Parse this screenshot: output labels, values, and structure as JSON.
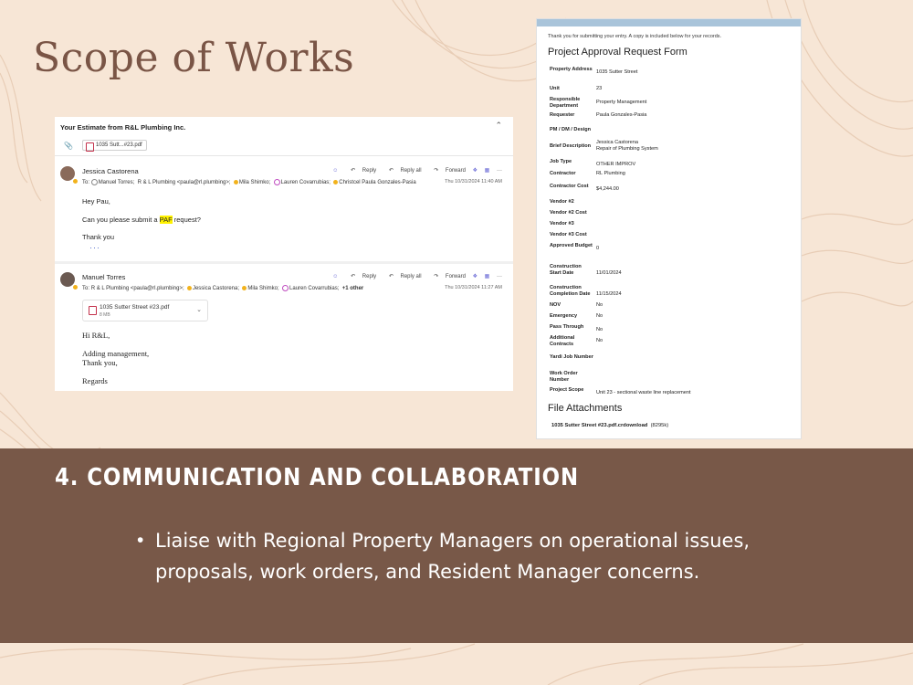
{
  "slide": {
    "title": "Scope of Works",
    "colors": {
      "background": "#f7e6d6",
      "band": "#785848",
      "title": "#7a5546"
    }
  },
  "email": {
    "subject": "Your Estimate from R&L Plumbing Inc.",
    "attachment_chip": "1035 Sutt...#23.pdf",
    "actions": {
      "reply": "Reply",
      "reply_all": "Reply all",
      "forward": "Forward",
      "more": "···"
    },
    "message1": {
      "sender": "Jessica Castorena",
      "to_label": "To:",
      "recipients": [
        "Manuel Torres;",
        "R & L Plumbing <paula@rl.plumbing>;",
        "Mila Shimko;",
        "Lauren Covarrubias;",
        "Christcel Paula Gonzales-Pasia"
      ],
      "date": "Thu 10/31/2024 11:40 AM",
      "greeting": "Hey Pau,",
      "line_before": "Can you please submit a ",
      "highlight": "PAF",
      "line_after": " request?",
      "closing": "Thank you",
      "expand": "···"
    },
    "message2": {
      "sender": "Manuel Torres",
      "to_label": "To:",
      "recipients": [
        "R & L Plumbing <paula@rl.plumbing>;",
        "Jessica Castorena;",
        "Mila Shimko;",
        "Lauren Covarrubias;"
      ],
      "others": "+1 other",
      "date": "Thu 10/31/2024 11:27 AM",
      "attachment_name": "1035 Sutter Street #23.pdf",
      "attachment_size": "8 MB",
      "greeting": "Hi R&L,",
      "line1": "Adding management,",
      "line2": "Thank you,",
      "closing": "Regards"
    }
  },
  "form": {
    "thanks": "Thank you for submitting your entry. A copy is included below for your records.",
    "title": "Project Approval Request Form",
    "fields": [
      {
        "label": "Property Address",
        "value": "1035 Sutter Street"
      },
      {
        "label": "Unit",
        "value": "23"
      },
      {
        "label": "Responsible Department",
        "value": "Property Management"
      },
      {
        "label": "Requester",
        "value": "Paula Gonzales-Pasia"
      },
      {
        "label": "PM / DM / Design",
        "value": "Jessica Castorena"
      },
      {
        "label": "Brief Description",
        "value": "Repair of Plumbing System"
      },
      {
        "label": "Job Type",
        "value": "OTHER IMPROV"
      },
      {
        "label": "Contractor",
        "value": "RL Plumbing"
      },
      {
        "label": "Contractor Cost",
        "value": "$4,244.00"
      },
      {
        "label": "Vendor #2",
        "value": ""
      },
      {
        "label": "Vendor #2 Cost",
        "value": ""
      },
      {
        "label": "Vendor #3",
        "value": ""
      },
      {
        "label": "Vendor #3 Cost",
        "value": ""
      },
      {
        "label": "Approved Budget",
        "value": "0"
      },
      {
        "label": "Construction Start Date",
        "value": "11/01/2024"
      },
      {
        "label": "Construction Completion Date",
        "value": "11/15/2024"
      },
      {
        "label": "NOV",
        "value": "No"
      },
      {
        "label": "Emergency",
        "value": "No"
      },
      {
        "label": "Pass Through",
        "value": "No"
      },
      {
        "label": "Additional Contracts",
        "value": "No"
      },
      {
        "label": "Yardi Job Number",
        "value": ""
      },
      {
        "label": "Work Order Number",
        "value": ""
      },
      {
        "label": "Project Scope",
        "value": "Unit 23 - sectional waste line replacement"
      }
    ],
    "attachments_title": "File Attachments",
    "file_name": "1035 Sutter Street #23.pdf.crdownload",
    "file_size": "(8295k)"
  },
  "section": {
    "heading": "4. COMMUNICATION AND COLLABORATION",
    "bullet": "Liaise with Regional Property Managers on operational issues, proposals, work orders, and Resident Manager concerns."
  }
}
